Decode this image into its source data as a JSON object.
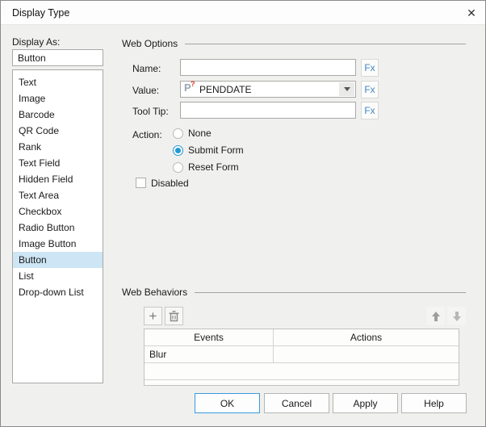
{
  "dialog": {
    "title": "Display Type"
  },
  "icons": {
    "close": "✕",
    "add": "+",
    "delete": "trash-can",
    "move_up": "up-arrow",
    "move_down": "down-arrow",
    "combo_arrow": "down-triangle",
    "param": {
      "p": "P",
      "q": "?"
    }
  },
  "left": {
    "display_as_label": "Display As:",
    "selected_value": "Button",
    "selected_item": "Button",
    "items": [
      "Text",
      "Image",
      "Barcode",
      "QR Code",
      "Rank",
      "Text Field",
      "Hidden Field",
      "Text Area",
      "Checkbox",
      "Radio Button",
      "Image Button",
      "Button",
      "List",
      "Drop-down List"
    ]
  },
  "web_options": {
    "section_title": "Web Options",
    "fx_label": "Fx",
    "fields": [
      {
        "label": "Name:",
        "value": "",
        "type": "text"
      },
      {
        "label": "Value:",
        "value": "PENDDATE",
        "type": "combo"
      },
      {
        "label": "Tool Tip:",
        "value": "",
        "type": "text"
      }
    ],
    "action_label": "Action:",
    "actions": [
      {
        "label": "None",
        "selected": false
      },
      {
        "label": "Submit Form",
        "selected": true
      },
      {
        "label": "Reset Form",
        "selected": false
      }
    ],
    "disabled_label": "Disabled",
    "disabled_checked": false
  },
  "web_behaviors": {
    "section_title": "Web Behaviors",
    "table": {
      "columns": [
        "Events",
        "Actions"
      ],
      "rows": [
        [
          "Blur",
          ""
        ]
      ]
    }
  },
  "footer": {
    "buttons": [
      "OK",
      "Cancel",
      "Apply",
      "Help"
    ]
  },
  "colors": {
    "accent_blue": "#2399d6",
    "fx_blue": "#4285c8",
    "selection_bg": "#cde5f4",
    "param_red": "#d83a30",
    "dialog_bg": "#f0f0ee",
    "titlebar_bg": "#fdfdfd"
  }
}
